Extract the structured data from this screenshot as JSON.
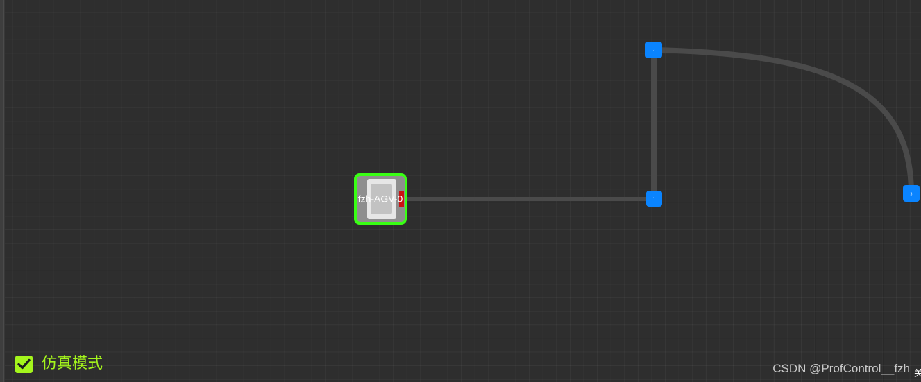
{
  "canvas": {
    "background": "#2e2e2e",
    "grid": true
  },
  "nodes": [
    {
      "id": "1",
      "label": "1"
    },
    {
      "id": "2",
      "label": "2"
    },
    {
      "id": "3",
      "label": "3"
    }
  ],
  "paths": [
    {
      "from": "1",
      "to": "2",
      "shape": "straight"
    },
    {
      "from": "2",
      "to": "3",
      "shape": "curve"
    },
    {
      "from": "agv",
      "to": "1",
      "shape": "straight"
    }
  ],
  "agv": {
    "name": "fzh-AGV-0",
    "highlight_color": "#39ff14",
    "status": "selected"
  },
  "node_color": "#0a84ff",
  "path_color": "#4a4a4a",
  "simulation": {
    "label": "仿真模式",
    "checked": true,
    "color": "#a4f51c"
  },
  "watermark": {
    "text": "CSDN @ProfControl__fzh"
  },
  "edge_glyph": "关"
}
